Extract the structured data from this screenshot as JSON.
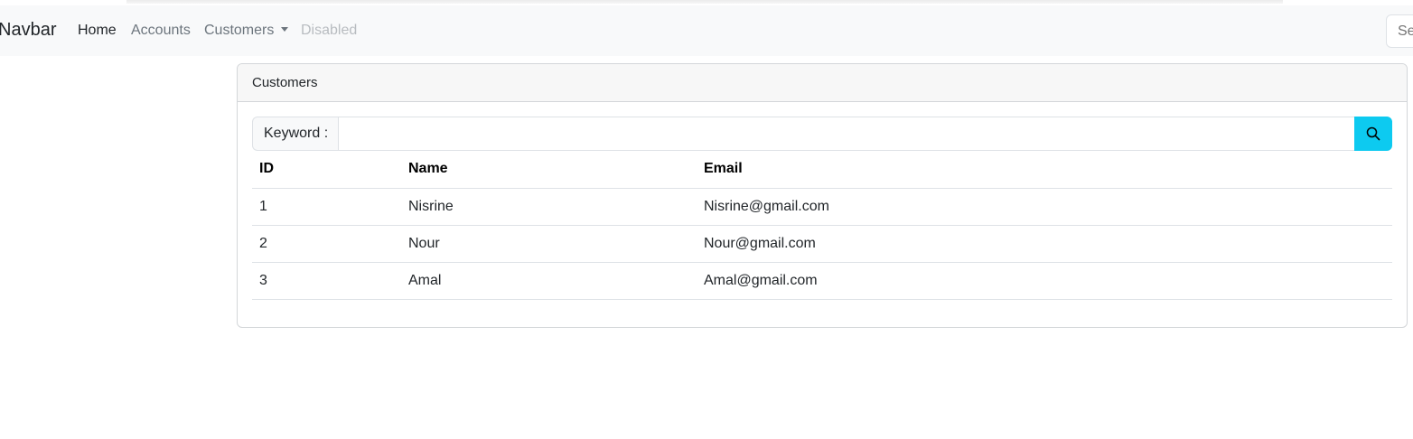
{
  "navbar": {
    "brand": "Navbar",
    "links": [
      {
        "label": "Home"
      },
      {
        "label": "Accounts"
      },
      {
        "label": "Customers"
      },
      {
        "label": "Disabled"
      }
    ],
    "search_placeholder": "Search"
  },
  "card": {
    "title": "Customers",
    "keyword_label": "Keyword :",
    "keyword_value": "",
    "search_icon": "search-icon",
    "accent_color": "#0dcaf0",
    "table": {
      "headers": [
        "ID",
        "Name",
        "Email"
      ],
      "rows": [
        {
          "id": "1",
          "name": "Nisrine",
          "email": "Nisrine@gmail.com"
        },
        {
          "id": "2",
          "name": "Nour",
          "email": "Nour@gmail.com"
        },
        {
          "id": "3",
          "name": "Amal",
          "email": "Amal@gmail.com"
        }
      ]
    }
  }
}
